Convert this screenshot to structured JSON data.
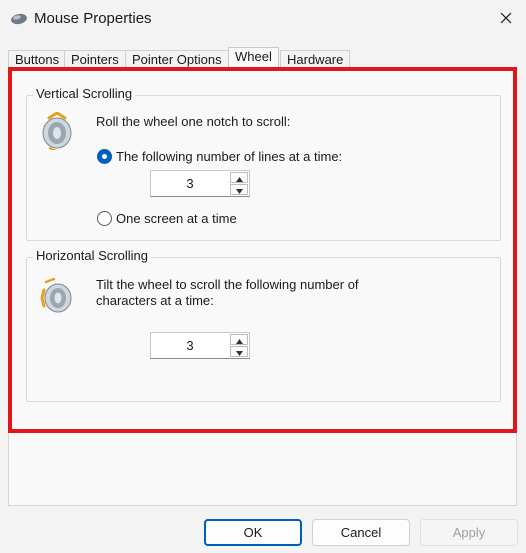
{
  "window": {
    "title": "Mouse Properties"
  },
  "tabs": [
    {
      "label": "Buttons"
    },
    {
      "label": "Pointers"
    },
    {
      "label": "Pointer Options"
    },
    {
      "label": "Wheel",
      "active": true
    },
    {
      "label": "Hardware"
    }
  ],
  "vertical": {
    "legend": "Vertical Scrolling",
    "instruction": "Roll the wheel one notch to scroll:",
    "option_lines": "The following number of lines at a time:",
    "option_lines_selected": true,
    "lines_value": "3",
    "option_screen": "One screen at a time"
  },
  "horizontal": {
    "legend": "Horizontal Scrolling",
    "instruction_line1": "Tilt the wheel to scroll the following number of",
    "instruction_line2": "characters at a time:",
    "chars_value": "3"
  },
  "buttons": {
    "ok": "OK",
    "cancel": "Cancel",
    "apply": "Apply"
  },
  "colors": {
    "highlight": "#e0161b",
    "accent": "#005fb8"
  }
}
